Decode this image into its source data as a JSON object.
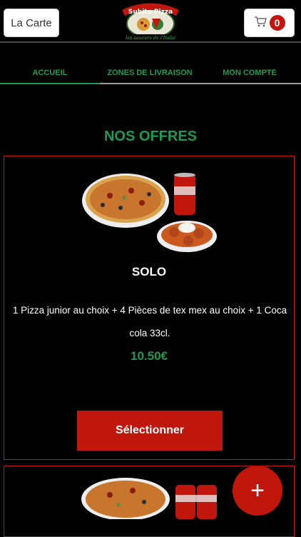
{
  "header": {
    "menu_label": "La Carte",
    "logo_title": "Subito Pizza",
    "logo_subtitle": "les saveurs de l'Italie",
    "cart_count": "0",
    "cart_icon": "cart-icon"
  },
  "tabs": [
    {
      "label": "ACCUEIL",
      "active": true
    },
    {
      "label": "ZONES DE LIVRAISON",
      "active": false
    },
    {
      "label": "MON COMPTE",
      "active": false
    }
  ],
  "section": {
    "title": "NOS OFFRES"
  },
  "offers": [
    {
      "title": "SOLO",
      "description": "1 Pizza junior au choix  + 4 Pièces de tex mex au choix  + 1 Coca cola 33cl.",
      "price": "10.50€",
      "button_label": "Sélectionner"
    }
  ],
  "fab": {
    "label": "+"
  },
  "colors": {
    "accent_green": "#1f9a52",
    "accent_red": "#c0160b",
    "background": "#000000"
  }
}
